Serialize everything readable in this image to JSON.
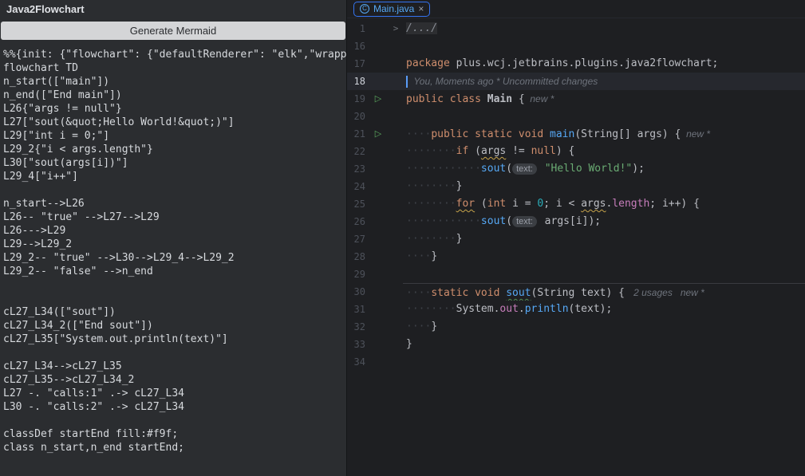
{
  "colors": {
    "editor_bg": "#1e1f22",
    "panel_bg": "#2b2d30",
    "accent_blue": "#3574f0",
    "keyword_orange": "#cf8e6d",
    "string_green": "#6aab73",
    "number_teal": "#2aacb8",
    "method_blue": "#56a8f5",
    "field_purple": "#c77dbb",
    "run_green": "#5cab5f",
    "startend_fill": "#f9f"
  },
  "glyphs": {
    "run_icon": "▷",
    "fold_icon": ">",
    "close_icon": "×"
  },
  "left_panel": {
    "title": "Java2Flowchart",
    "button_label": "Generate Mermaid",
    "mermaid_source": "%%{init: {\"flowchart\": {\"defaultRenderer\": \"elk\",\"wrapp\nflowchart TD\nn_start([\"main\"])\nn_end([\"End main\"])\nL26{\"args != null\"}\nL27[\"sout(&quot;Hello World!&quot;)\"]\nL29[\"int i = 0;\"]\nL29_2{\"i < args.length\"}\nL30[\"sout(args[i])\"]\nL29_4[\"i++\"]\n\nn_start-->L26\nL26-- \"true\" -->L27-->L29\nL26--->L29\nL29-->L29_2\nL29_2-- \"true\" -->L30-->L29_4-->L29_2\nL29_2-- \"false\" -->n_end\n\n\ncL27_L34([\"sout\"])\ncL27_L34_2([\"End sout\"])\ncL27_L35[\"System.out.println(text)\"]\n\ncL27_L34-->cL27_L35\ncL27_L35-->cL27_L34_2\nL27 -. \"calls:1\" .-> cL27_L34\nL30 -. \"calls:2\" .-> cL27_L34\n\nclassDef startEnd fill:#f9f;\nclass n_start,n_end startEnd;"
  },
  "editor": {
    "tab": {
      "icon_letter": "C",
      "label": "Main.java",
      "close_glyph": "×"
    },
    "lines": [
      {
        "n": "1",
        "fold": true,
        "tokens": [
          [
            "fold",
            "/.../"
          ]
        ]
      },
      {
        "n": "16",
        "tokens": []
      },
      {
        "n": "17",
        "tokens": [
          [
            "kw",
            "package"
          ],
          [
            "pl",
            " plus.wcj.jetbrains.plugins.java2flowchart;"
          ]
        ]
      },
      {
        "n": "18",
        "cur": true,
        "tokens": [
          [
            "caret",
            ""
          ],
          [
            "ghost",
            "  You, Moments ago * Uncommitted changes"
          ]
        ]
      },
      {
        "n": "19",
        "run": true,
        "tokens": [
          [
            "kw",
            "public class "
          ],
          [
            "pl b",
            "Main"
          ],
          [
            "pl",
            " {"
          ],
          [
            "ghost",
            "  new *"
          ]
        ]
      },
      {
        "n": "20",
        "tokens": []
      },
      {
        "n": "21",
        "run": true,
        "tokens": [
          [
            "ws",
            "····"
          ],
          [
            "kw",
            "public static void "
          ],
          [
            "fn",
            "main"
          ],
          [
            "pl",
            "(String[] args) {"
          ],
          [
            "ghost",
            "  new *"
          ]
        ]
      },
      {
        "n": "22",
        "tokens": [
          [
            "ws",
            "········"
          ],
          [
            "kw",
            "if"
          ],
          [
            "pl",
            " ("
          ],
          [
            "pl warn",
            "args"
          ],
          [
            "pl",
            " != "
          ],
          [
            "kw",
            "null"
          ],
          [
            "pl",
            ") {"
          ]
        ]
      },
      {
        "n": "23",
        "tokens": [
          [
            "ws",
            "············"
          ],
          [
            "fn",
            "sout"
          ],
          [
            "pl",
            "("
          ],
          [
            "pill",
            "text:"
          ],
          [
            "pl",
            " "
          ],
          [
            "str",
            "\"Hello World!\""
          ],
          [
            "pl",
            ");"
          ]
        ]
      },
      {
        "n": "24",
        "tokens": [
          [
            "ws",
            "········"
          ],
          [
            "pl",
            "}"
          ]
        ]
      },
      {
        "n": "25",
        "tokens": [
          [
            "ws",
            "········"
          ],
          [
            "kw warn",
            "for"
          ],
          [
            "pl",
            " ("
          ],
          [
            "kw",
            "int"
          ],
          [
            "pl",
            " i = "
          ],
          [
            "num",
            "0"
          ],
          [
            "pl",
            "; i < "
          ],
          [
            "pl warn",
            "args"
          ],
          [
            "pl",
            "."
          ],
          [
            "fld",
            "length"
          ],
          [
            "pl",
            "; i++) {"
          ]
        ]
      },
      {
        "n": "26",
        "tokens": [
          [
            "ws",
            "············"
          ],
          [
            "fn",
            "sout"
          ],
          [
            "pl",
            "("
          ],
          [
            "pill",
            "text:"
          ],
          [
            "pl",
            " args[i]);"
          ]
        ]
      },
      {
        "n": "27",
        "tokens": [
          [
            "ws",
            "········"
          ],
          [
            "pl",
            "}"
          ]
        ]
      },
      {
        "n": "28",
        "tokens": [
          [
            "ws",
            "····"
          ],
          [
            "pl",
            "}"
          ]
        ]
      },
      {
        "n": "29",
        "tokens": []
      },
      {
        "n": "30",
        "sep": true,
        "tokens": [
          [
            "ws",
            "····"
          ],
          [
            "kw",
            "static void "
          ],
          [
            "fn typo",
            "sout"
          ],
          [
            "pl",
            "(String text) { "
          ],
          [
            "ghost",
            " 2 usages   new *"
          ]
        ]
      },
      {
        "n": "31",
        "tokens": [
          [
            "ws",
            "········"
          ],
          [
            "pl",
            "System."
          ],
          [
            "fld",
            "out"
          ],
          [
            "pl",
            "."
          ],
          [
            "fn",
            "println"
          ],
          [
            "pl",
            "(text);"
          ]
        ]
      },
      {
        "n": "32",
        "tokens": [
          [
            "ws",
            "····"
          ],
          [
            "pl",
            "}"
          ]
        ]
      },
      {
        "n": "33",
        "tokens": [
          [
            "pl",
            "}"
          ]
        ]
      },
      {
        "n": "34",
        "tokens": []
      }
    ]
  }
}
